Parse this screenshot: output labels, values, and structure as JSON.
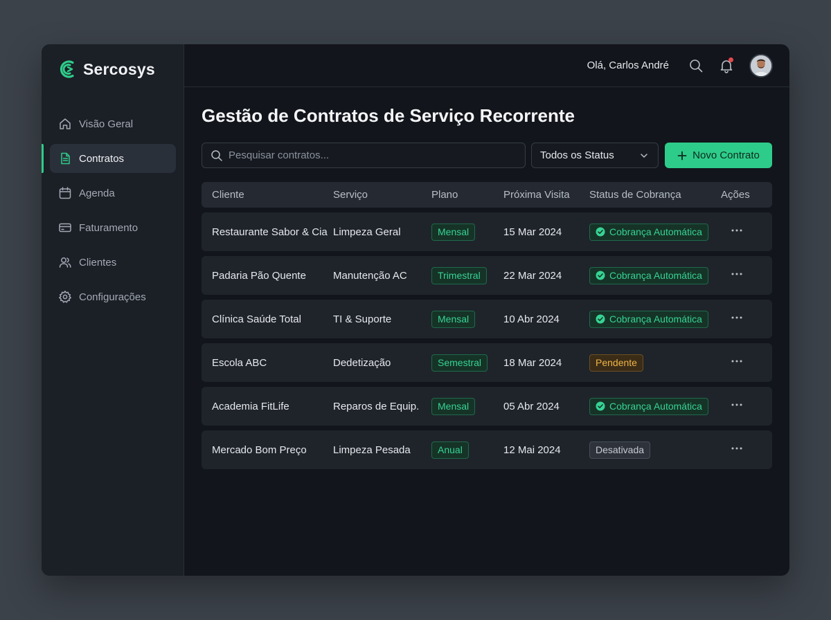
{
  "brand": {
    "name": "Sercosys",
    "icon": "brand-logo-icon",
    "accent": "#2ecc8a"
  },
  "sidebar": {
    "items": [
      {
        "label": "Visão Geral",
        "icon": "home-icon",
        "active": false
      },
      {
        "label": "Contratos",
        "icon": "document-icon",
        "active": true
      },
      {
        "label": "Agenda",
        "icon": "calendar-icon",
        "active": false
      },
      {
        "label": "Faturamento",
        "icon": "credit-card-icon",
        "active": false
      },
      {
        "label": "Clientes",
        "icon": "users-icon",
        "active": false
      },
      {
        "label": "Configurações",
        "icon": "gear-icon",
        "active": false
      }
    ]
  },
  "header": {
    "greeting": "Olá, Carlos André",
    "icons": [
      "search-icon",
      "bell-icon"
    ],
    "notification_dot_color": "#e5484d"
  },
  "page": {
    "title": "Gestão de Contratos de Serviço Recorrente"
  },
  "toolbar": {
    "search_placeholder": "Pesquisar contratos...",
    "status_filter": "Todos os Status",
    "new_button": "Novo Contrato"
  },
  "table": {
    "columns": [
      "Cliente",
      "Serviço",
      "Plano",
      "Próxima Visita",
      "Status de Cobrança",
      "Ações"
    ],
    "rows": [
      {
        "cliente": "Restaurante Sabor & Cia",
        "servico": "Limpeza Geral",
        "plano": "Mensal",
        "visita": "15 Mar 2024",
        "status": "Cobrança Automática",
        "status_type": "ok"
      },
      {
        "cliente": "Padaria Pão Quente",
        "servico": "Manutenção AC",
        "plano": "Trimestral",
        "visita": "22 Mar 2024",
        "status": "Cobrança Automática",
        "status_type": "ok"
      },
      {
        "cliente": "Clínica Saúde Total",
        "servico": "TI & Suporte",
        "plano": "Mensal",
        "visita": "10 Abr 2024",
        "status": "Cobrança Automática",
        "status_type": "ok"
      },
      {
        "cliente": "Escola ABC",
        "servico": "Dedetização",
        "plano": "Semestral",
        "visita": "18 Mar 2024",
        "status": "Pendente",
        "status_type": "pending"
      },
      {
        "cliente": "Academia FitLife",
        "servico": "Reparos de Equip.",
        "plano": "Mensal",
        "visita": "05 Abr 2024",
        "status": "Cobrança Automática",
        "status_type": "ok"
      },
      {
        "cliente": "Mercado Bom Preço",
        "servico": "Limpeza Pesada",
        "plano": "Anual",
        "visita": "12 Mai 2024",
        "status": "Desativada",
        "status_type": "off"
      }
    ],
    "status_colors": {
      "ok": "#36d394",
      "pending": "#f0b548",
      "off": "#c6cbd2"
    }
  }
}
